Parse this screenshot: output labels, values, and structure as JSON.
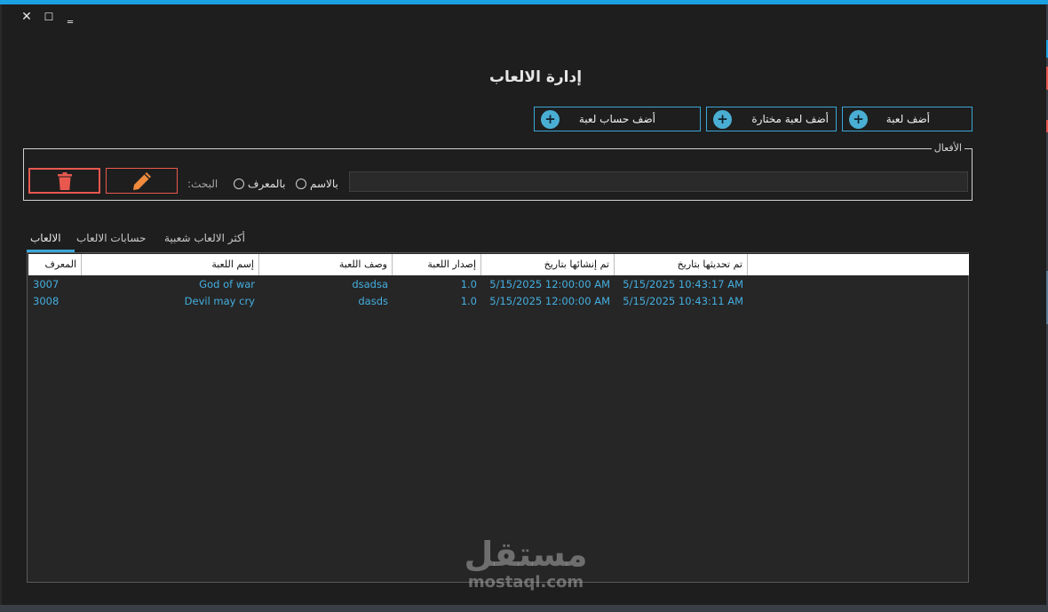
{
  "window": {
    "title": "إدارة الالعاب",
    "controls": {
      "close": "✕",
      "maximize": "☐",
      "minimize": "‗"
    }
  },
  "toolbar": {
    "add_game": "أضف لعبة",
    "add_selected_game": "أضف لعبة مختارة",
    "add_game_account": "أضف حساب لعبة"
  },
  "actions": {
    "legend": "الأفعال",
    "search_label": ":البحث",
    "by_id": "بالمعرف",
    "by_name": "بالاسم",
    "search_value": ""
  },
  "tabs": [
    {
      "label": "الالعاب",
      "active": true
    },
    {
      "label": "حسابات الالعاب",
      "active": false
    },
    {
      "label": "أكثر الالعاب شعبية",
      "active": false
    }
  ],
  "table": {
    "columns": [
      "المعرف",
      "إسم اللعبة",
      "وصف اللعبة",
      "إصدار اللعبة",
      "تم إنشائها بتاريخ",
      "تم تحديثها بتاريخ"
    ],
    "rows": [
      [
        "3007",
        "God of war",
        "dsadsa",
        "1.0",
        "5/15/2025 12:00:00 AM",
        "5/15/2025 10:43:17 AM"
      ],
      [
        "3008",
        "Devil may cry",
        "dasds",
        "1.0",
        "5/15/2025 12:00:00 AM",
        "5/15/2025 10:43:11 AM"
      ]
    ]
  },
  "watermark": {
    "arabic": "مستقل",
    "latin": "mostaql.com"
  },
  "colors": {
    "accent": "#1ba1e2",
    "button_border": "#3aa6d8",
    "danger": "#e8584f",
    "edit": "#f08a3c",
    "row_text": "#44aee0",
    "background": "#1e1e1e"
  },
  "icons": {
    "delete": "trash-icon",
    "edit": "pencil-icon",
    "add": "plus-icon"
  }
}
